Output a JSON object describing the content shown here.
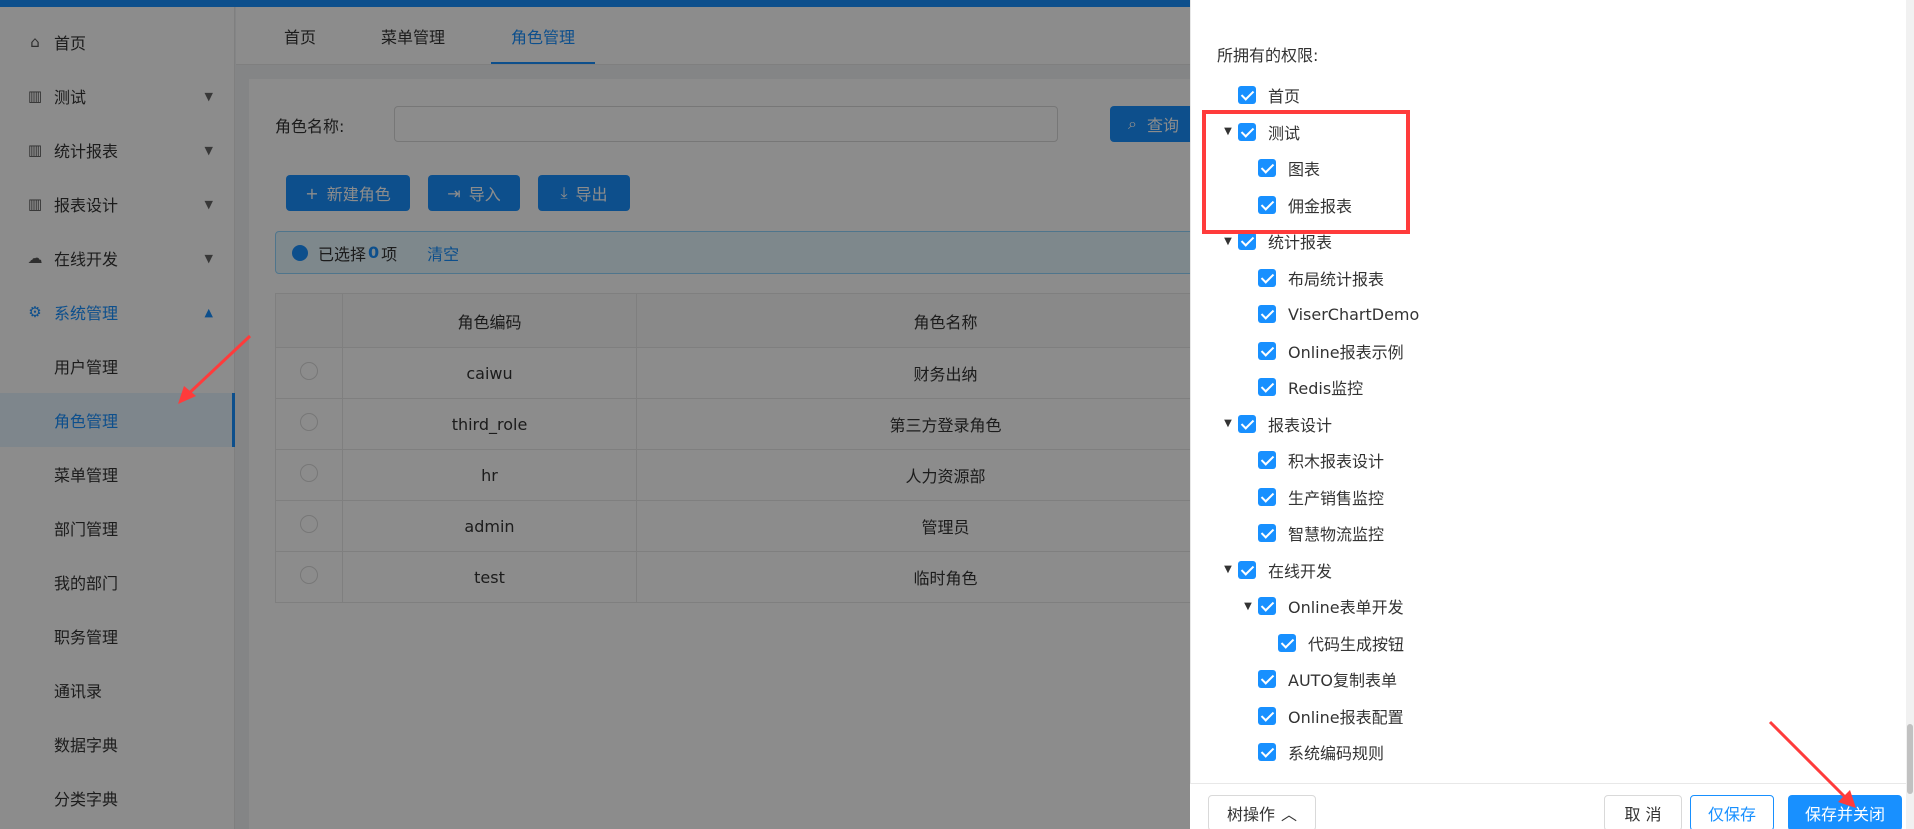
{
  "sidebar": {
    "items": [
      {
        "label": "首页",
        "icon": "home-icon",
        "glyph": "⌂"
      },
      {
        "label": "测试",
        "icon": "chart-icon",
        "glyph": "▥"
      },
      {
        "label": "统计报表",
        "icon": "chart-icon",
        "glyph": "▥"
      },
      {
        "label": "报表设计",
        "icon": "chart-icon",
        "glyph": "▥"
      },
      {
        "label": "在线开发",
        "icon": "cloud-icon",
        "glyph": "☁"
      },
      {
        "label": "系统管理",
        "icon": "gear-icon",
        "glyph": "⚙"
      }
    ],
    "sub_items": [
      "用户管理",
      "角色管理",
      "菜单管理",
      "部门管理",
      "我的部门",
      "职务管理",
      "通讯录",
      "数据字典",
      "分类字典"
    ]
  },
  "tabs": [
    "首页",
    "菜单管理",
    "角色管理"
  ],
  "search": {
    "label": "角色名称:",
    "query_label": "查询"
  },
  "toolbar": {
    "new_label": "新建角色",
    "import_label": "导入",
    "export_label": "导出"
  },
  "selection": {
    "prefix": "已选择",
    "count": "0",
    "suffix": "项",
    "clear_label": "清空"
  },
  "table": {
    "headers": [
      "",
      "角色编码",
      "角色名称"
    ],
    "rows": [
      {
        "code": "caiwu",
        "name": "财务出纳"
      },
      {
        "code": "third_role",
        "name": "第三方登录角色"
      },
      {
        "code": "hr",
        "name": "人力资源部"
      },
      {
        "code": "admin",
        "name": "管理员"
      },
      {
        "code": "test",
        "name": "临时角色"
      }
    ]
  },
  "drawer": {
    "perm_title": "所拥有的权限:",
    "tree": [
      {
        "label": "首页",
        "level": 0,
        "expand": false
      },
      {
        "label": "测试",
        "level": 0,
        "expand": true
      },
      {
        "label": "图表",
        "level": 1,
        "expand": false
      },
      {
        "label": "佣金报表",
        "level": 1,
        "expand": false
      },
      {
        "label": "统计报表",
        "level": 0,
        "expand": true
      },
      {
        "label": "布局统计报表",
        "level": 1,
        "expand": false
      },
      {
        "label": "ViserChartDemo",
        "level": 1,
        "expand": false
      },
      {
        "label": "Online报表示例",
        "level": 1,
        "expand": false
      },
      {
        "label": "Redis监控",
        "level": 1,
        "expand": false
      },
      {
        "label": "报表设计",
        "level": 0,
        "expand": true
      },
      {
        "label": "积木报表设计",
        "level": 1,
        "expand": false
      },
      {
        "label": "生产销售监控",
        "level": 1,
        "expand": false
      },
      {
        "label": "智慧物流监控",
        "level": 1,
        "expand": false
      },
      {
        "label": "在线开发",
        "level": 0,
        "expand": true
      },
      {
        "label": "Online表单开发",
        "level": 1,
        "expand": true
      },
      {
        "label": "代码生成按钮",
        "level": 2,
        "expand": false
      },
      {
        "label": "AUTO复制表单",
        "level": 1,
        "expand": false
      },
      {
        "label": "Online报表配置",
        "level": 1,
        "expand": false
      },
      {
        "label": "系统编码规则",
        "level": 1,
        "expand": false
      }
    ],
    "footer": {
      "tree_ops": "树操作",
      "cancel": "取 消",
      "save_only": "仅保存",
      "save_close": "保存并关闭"
    }
  },
  "colors": {
    "primary": "#1890ff",
    "highlight": "#ff3b3b"
  }
}
